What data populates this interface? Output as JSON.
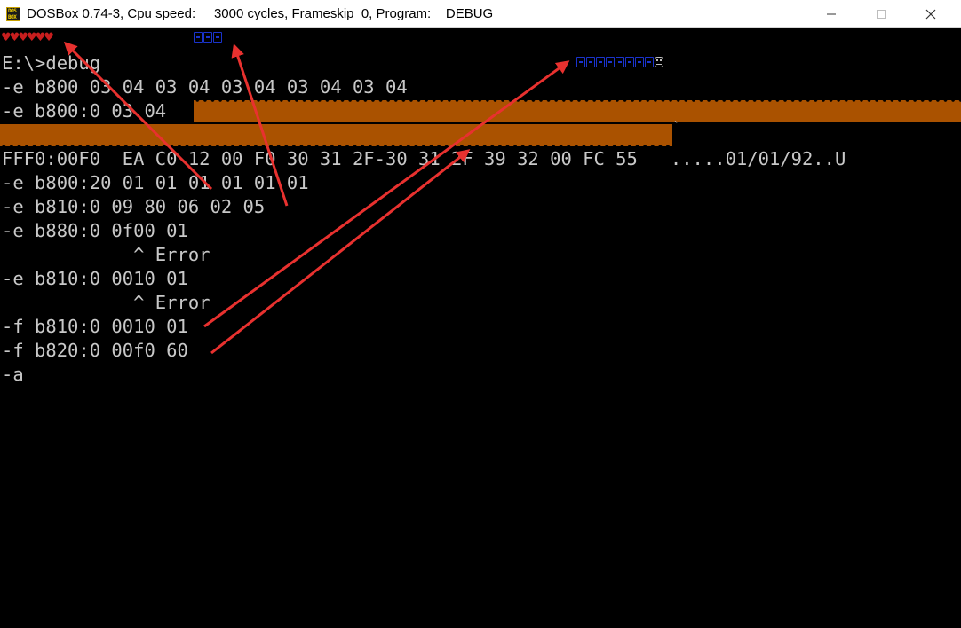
{
  "window": {
    "title": "DOSBox 0.74-3, Cpu speed:     3000 cycles, Frameskip  0, Program:    DEBUG",
    "icon_text_line1": "DOS",
    "icon_text_line2": "BOX",
    "controls": [
      "minimize-icon",
      "maximize-icon",
      "close-icon"
    ]
  },
  "video_row0": {
    "hearts": "♥♥♥♥♥♥",
    "colors": {
      "heart": "#c81e1e",
      "blue_glyph": "#1a33cc",
      "fill": "#aa5200"
    }
  },
  "console": {
    "lines": [
      "E:\\>debug",
      "-e b800 03 04 03 04 03 04 03 04 03 04",
      "-e b800:0 03 04",
      "",
      "FFF0:00F0  EA C0 12 00 F0 30 31 2F-30 31 2F 39 32 00 FC 55   .....01/01/92..U",
      "-e b800:20 01 01 01 01 01 01",
      "-e b810:0 09 80 06 02 05",
      "-e b880:0 0f00 01",
      "            ^ Error",
      "-e b810:0 0010 01",
      "            ^ Error",
      "-f b810:0 0010 01",
      "-f b820:0 00f0 60",
      "-a"
    ]
  },
  "annotation": {
    "arrow_color": "#e8312f"
  }
}
